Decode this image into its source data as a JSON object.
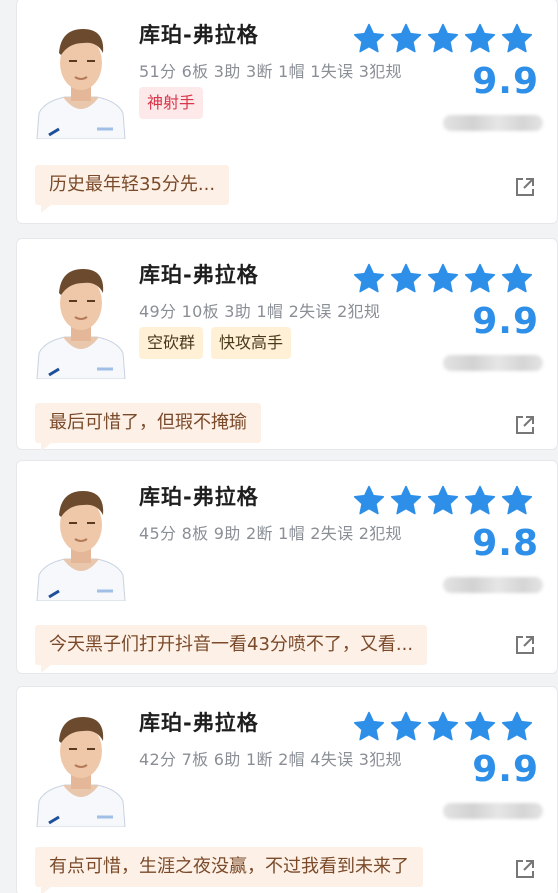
{
  "colors": {
    "star": "#2d8fe8",
    "score": "#2d8fe8",
    "tag_red_bg": "#fde8ea",
    "tag_orange_bg": "#fff0d6",
    "comment_bg": "#fdf0e6"
  },
  "cards": [
    {
      "player_name": "库珀-弗拉格",
      "stats": "51分 6板 3助 3断 1帽 1失误 3犯规",
      "tags": [
        {
          "label": "神射手",
          "style": "red"
        }
      ],
      "stars": 5,
      "score": "9.9",
      "comment": "历史最年轻35分先...",
      "avatar_icon": "player-photo",
      "share_icon": "share-external-icon"
    },
    {
      "player_name": "库珀-弗拉格",
      "stats": "49分 10板 3助 1帽 2失误 2犯规",
      "tags": [
        {
          "label": "空砍群",
          "style": "orange"
        },
        {
          "label": "快攻高手",
          "style": "orange"
        }
      ],
      "stars": 5,
      "score": "9.9",
      "comment": "最后可惜了，但瑕不掩瑜",
      "avatar_icon": "player-photo",
      "share_icon": "share-external-icon"
    },
    {
      "player_name": "库珀-弗拉格",
      "stats": "45分 8板 9助 2断 1帽 2失误 2犯规",
      "tags": [],
      "stars": 5,
      "score": "9.8",
      "comment": "今天黑子们打开抖音一看43分喷不了，又看...",
      "avatar_icon": "player-photo",
      "share_icon": "share-external-icon"
    },
    {
      "player_name": "库珀-弗拉格",
      "stats": "42分 7板 6助 1断 2帽 4失误 3犯规",
      "tags": [],
      "stars": 5,
      "score": "9.9",
      "comment": "有点可惜，生涯之夜没赢，不过我看到未来了",
      "avatar_icon": "player-photo",
      "share_icon": "share-external-icon"
    }
  ]
}
